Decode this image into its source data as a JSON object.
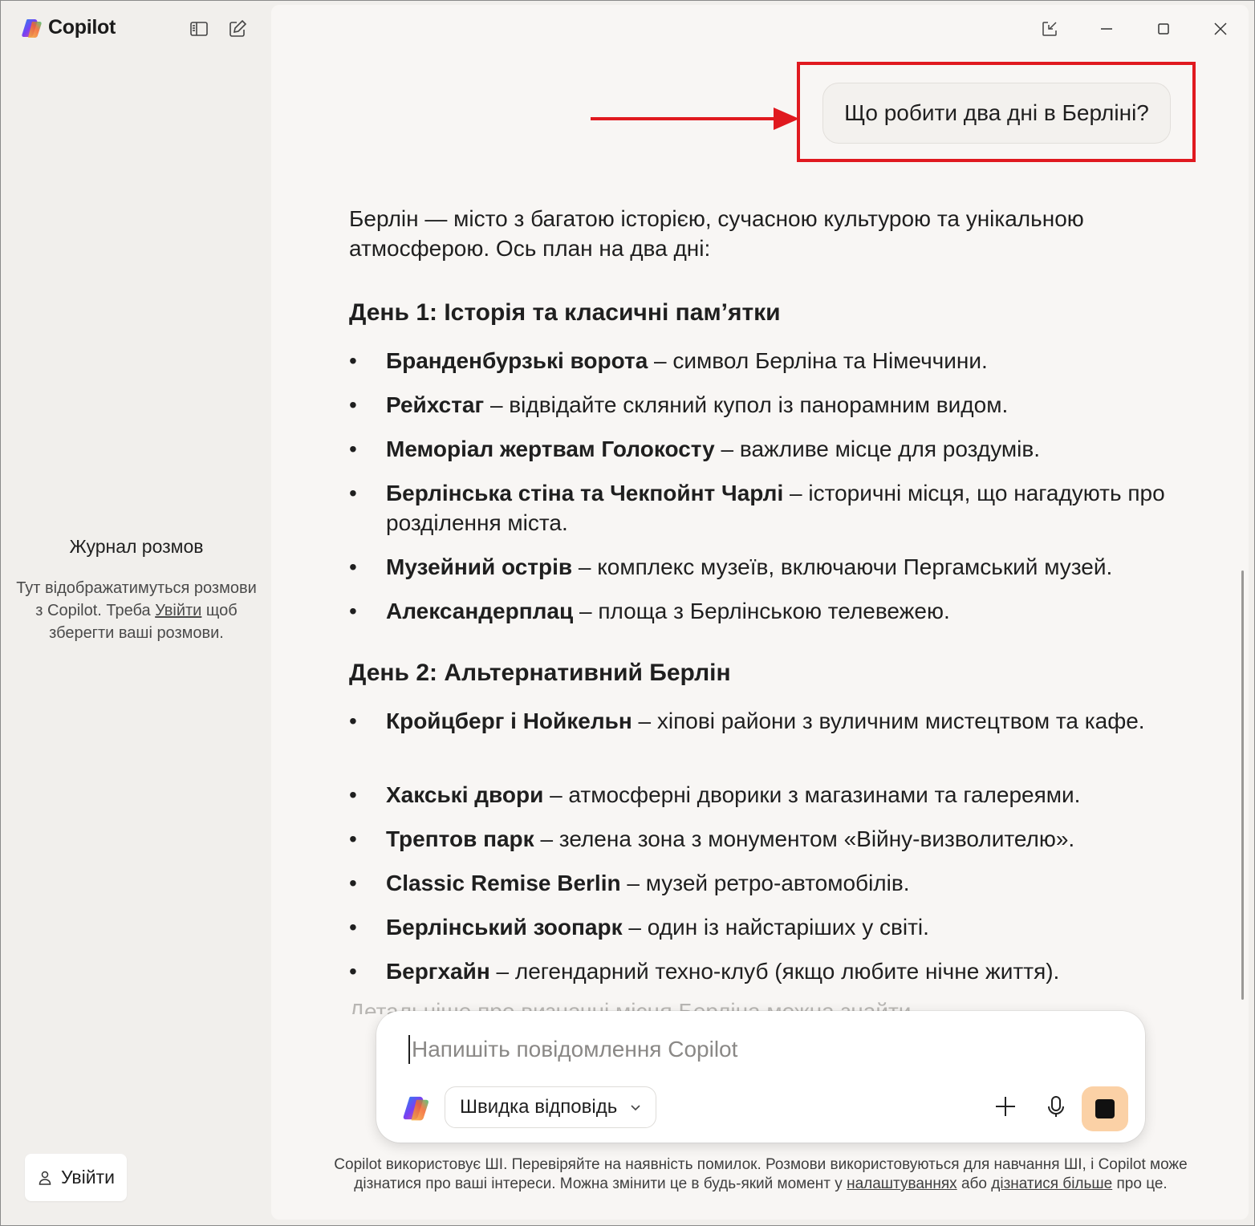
{
  "app": {
    "name": "Copilot"
  },
  "sidebar": {
    "history_title": "Журнал розмов",
    "history_text_before": "Тут відображатимуться розмови з Copilot. Треба",
    "history_link": "Увійти",
    "history_text_after": "щоб зберегти ваші розмови.",
    "signin_label": "Увійти"
  },
  "conversation": {
    "user_message": "Що робити два дні в Берліні?",
    "intro": "Берлін — місто з багатою історією, сучасною культурою та унікальною атмосферою. Ось план на два дні:",
    "day1": {
      "heading": "День 1: Історія та класичні пам’ятки",
      "items": [
        {
          "bold": "Бранденбурзькі ворота",
          "text": " – символ Берліна та Німеччини."
        },
        {
          "bold": "Рейхстаг",
          "text": " – відвідайте скляний купол із панорамним видом."
        },
        {
          "bold": "Меморіал жертвам Голокосту",
          "text": " – важливе місце для роздумів."
        },
        {
          "bold": "Берлінська стіна та Чекпойнт Чарлі",
          "text": " – історичні місця, що нагадують про розділення міста."
        },
        {
          "bold": "Музейний острів",
          "text": " – комплекс музеїв, включаючи Пергамський музей."
        },
        {
          "bold": "Александерплац",
          "text": " – площа з Берлінською телевежею."
        }
      ]
    },
    "day2": {
      "heading": "День 2: Альтернативний Берлін",
      "items": [
        {
          "bold": "Кройцберг і Нойкельн",
          "text": " – хіпові райони з вуличним мистецтвом та кафе."
        },
        {
          "bold": "Хакські двори",
          "text": " – атмосферні дворики з магазинами та галереями."
        },
        {
          "bold": "Трептов парк",
          "text": " – зелена зона з монументом «Війну-визволителю»."
        },
        {
          "bold": "Classic Remise Berlin",
          "text": " – музей ретро-автомобілів."
        },
        {
          "bold": "Берлінський зоопарк",
          "text": " – один із найстаріших у світі."
        },
        {
          "bold": "Бергхайн",
          "text": " – легендарний техно-клуб (якщо любите нічне життя)."
        }
      ]
    },
    "trailing_faded": "Детальніше про визначні місця Берліна можна знайти..."
  },
  "composer": {
    "placeholder": "Напишіть повідомлення Copilot",
    "mode_label": "Швидка відповідь"
  },
  "disclaimer": {
    "line_before": "Copilot використовує ШІ. Перевіряйте на наявність помилок. Розмови використовуються для навчання ШІ, і Copilot може дізнатися про ваші інтереси. Можна змінити це в будь-який момент у",
    "link_settings": "налаштуваннях",
    "middle": "або",
    "link_learn": "дізнатися більше",
    "line_after": "про це."
  },
  "colors": {
    "highlight": "#e0191f",
    "stop_button": "#fbd1a6",
    "main_bg": "#f8f6f4",
    "sidebar_bg": "#f1efec"
  },
  "icons": [
    "copilot-logo",
    "sidebar-toggle-icon",
    "new-chat-icon",
    "popout-icon",
    "minimize-icon",
    "maximize-icon",
    "close-icon",
    "person-icon",
    "chevron-down-icon",
    "plus-icon",
    "microphone-icon",
    "stop-icon"
  ]
}
